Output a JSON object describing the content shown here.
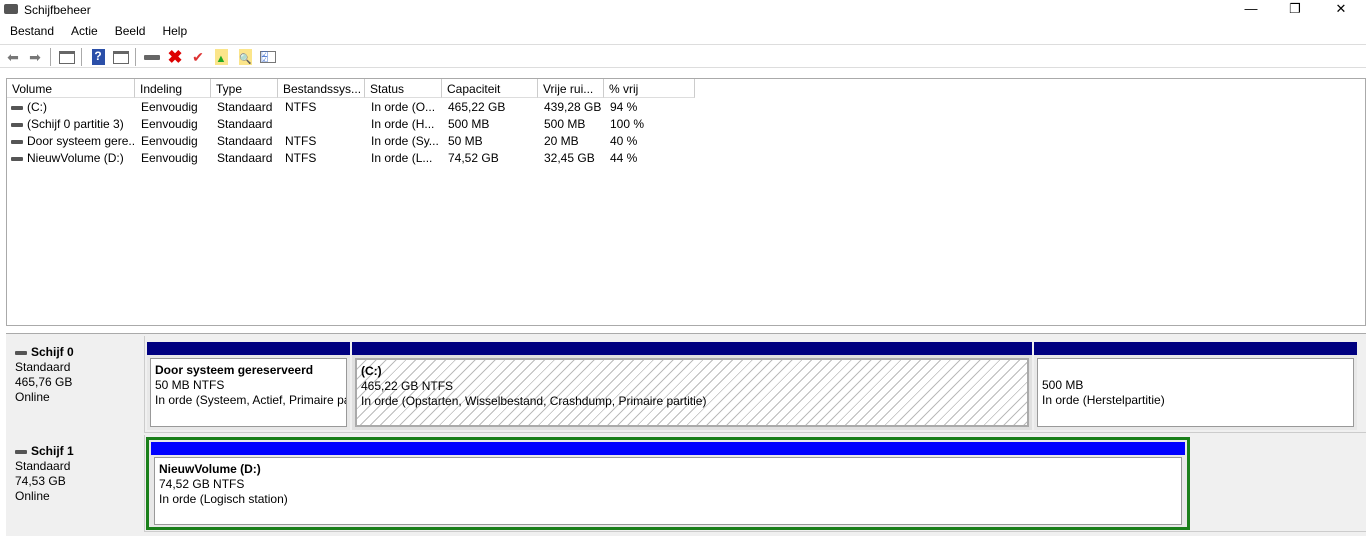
{
  "window": {
    "title": "Schijfbeheer",
    "minimize": "—",
    "restore": "❐",
    "close": "✕"
  },
  "menu": [
    "Bestand",
    "Actie",
    "Beeld",
    "Help"
  ],
  "toolbar": [
    "back-icon",
    "forward-icon",
    "console-tree-icon",
    "help-icon",
    "action-pane-icon",
    "connect-drive-icon",
    "delete-icon",
    "check-icon",
    "folder-up-icon",
    "folder-search-icon",
    "properties-list-icon"
  ],
  "table": {
    "columns": [
      "Volume",
      "Indeling",
      "Type",
      "Bestandssys...",
      "Status",
      "Capaciteit",
      "Vrije rui...",
      "% vrij"
    ],
    "rows": [
      [
        "(C:)",
        "Eenvoudig",
        "Standaard",
        "NTFS",
        "In orde (O...",
        "465,22 GB",
        "439,28 GB",
        "94 %"
      ],
      [
        "(Schijf 0 partitie 3)",
        "Eenvoudig",
        "Standaard",
        "",
        "In orde (H...",
        "500 MB",
        "500 MB",
        "100 %"
      ],
      [
        "Door systeem gere...",
        "Eenvoudig",
        "Standaard",
        "NTFS",
        "In orde (Sy...",
        "50 MB",
        "20 MB",
        "40 %"
      ],
      [
        "NieuwVolume (D:)",
        "Eenvoudig",
        "Standaard",
        "NTFS",
        "In orde (L...",
        "74,52 GB",
        "32,45 GB",
        "44 %"
      ]
    ]
  },
  "disks": [
    {
      "name": "Schijf 0",
      "type": "Standaard",
      "size": "465,76 GB",
      "state": "Online",
      "partitions": [
        {
          "title": "Door systeem gereserveerd",
          "size": "50 MB NTFS",
          "status": "In orde (Systeem, Actief, Primaire pa"
        },
        {
          "title": "(C:)",
          "size": "465,22 GB NTFS",
          "status": "In orde (Opstarten, Wisselbestand, Crashdump, Primaire partitie)"
        },
        {
          "title": "",
          "size": "500 MB",
          "status": "In orde (Herstelpartitie)"
        }
      ]
    },
    {
      "name": "Schijf 1",
      "type": "Standaard",
      "size": "74,53 GB",
      "state": "Online",
      "partitions": [
        {
          "title": "NieuwVolume  (D:)",
          "size": "74,52 GB NTFS",
          "status": "In orde (Logisch station)"
        }
      ]
    }
  ],
  "colors": {
    "primary_bar": "#000080",
    "logical_bar": "#0000ff",
    "selected_border": "#1a7f1a"
  }
}
